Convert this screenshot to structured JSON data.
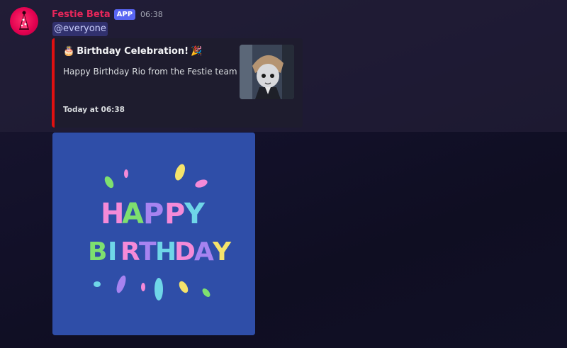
{
  "message": {
    "author": "Festie Beta",
    "badge": "APP",
    "time": "06:38",
    "content_mention": "@everyone"
  },
  "embed": {
    "accent_color": "#e01010",
    "title_prefix_emoji": "🎂",
    "title": "Birthday Celebration!",
    "title_suffix_emoji": "🎉",
    "description": "Happy Birthday Rio from the Festie team",
    "footer": "Today at 06:38",
    "thumbnail_icon": "character-thumbnail"
  },
  "attachment": {
    "line1": "HAPPY",
    "line2": "BIRTHDAY",
    "background": "#2f4ea8"
  },
  "colors": {
    "author": "#e6265a",
    "badge": "#5865f2",
    "mention_bg": "#5865f24d"
  }
}
